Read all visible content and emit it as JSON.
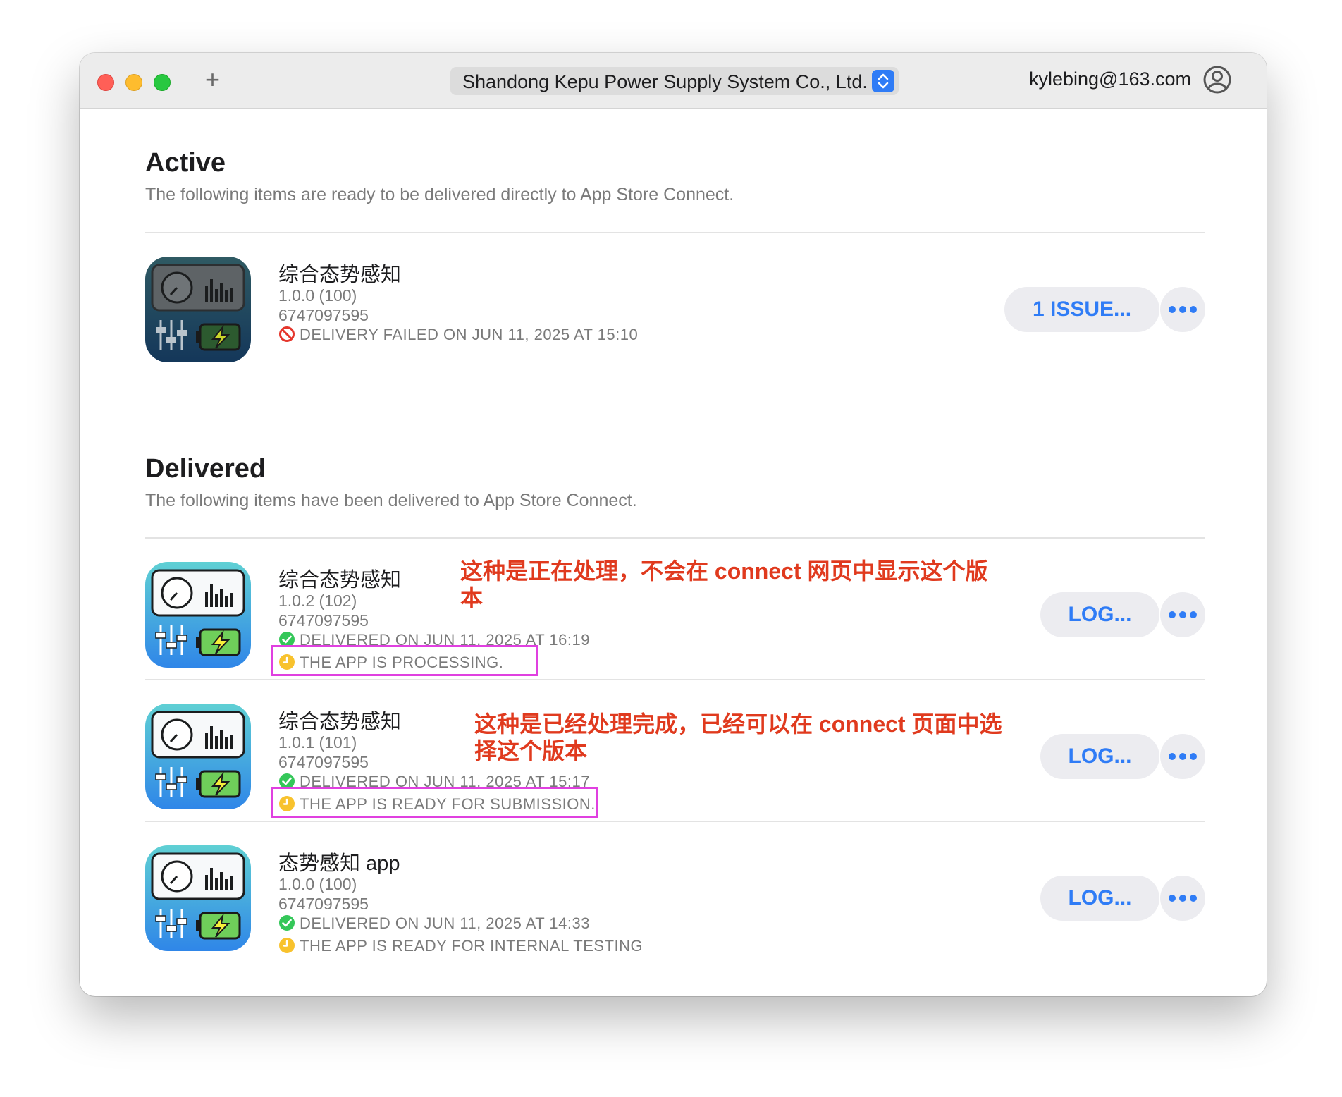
{
  "window": {
    "team": "Shandong Kepu Power Supply System Co., Ltd.",
    "account": "kylebing@163.com"
  },
  "active": {
    "title": "Active",
    "subtitle": "The following items are ready to be delivered directly to App Store Connect.",
    "items": [
      {
        "name": "综合态势感知",
        "version": "1.0.0 (100)",
        "app_id": "6747097595",
        "status": "DELIVERY FAILED ON JUN 11, 2025 AT 15:10",
        "action_label": "1 ISSUE..."
      }
    ]
  },
  "delivered": {
    "title": "Delivered",
    "subtitle": "The following items have been delivered to App Store Connect.",
    "items": [
      {
        "name": "综合态势感知",
        "version": "1.0.2 (102)",
        "app_id": "6747097595",
        "status": "DELIVERED ON JUN 11, 2025 AT 16:19",
        "processing": "THE APP IS PROCESSING.",
        "action_label": "LOG..."
      },
      {
        "name": "综合态势感知",
        "version": "1.0.1 (101)",
        "app_id": "6747097595",
        "status": "DELIVERED ON JUN 11, 2025 AT 15:17",
        "processing": "THE APP IS READY FOR SUBMISSION.",
        "action_label": "LOG..."
      },
      {
        "name": "态势感知 app",
        "version": "1.0.0 (100)",
        "app_id": "6747097595",
        "status": "DELIVERED ON JUN 11, 2025 AT 14:33",
        "processing": "THE APP IS READY FOR INTERNAL TESTING",
        "action_label": "LOG..."
      }
    ]
  },
  "annotations": {
    "processing_note": "这种是正在处理，不会在 connect 网页中显示这个版本",
    "ready_note": "这种是已经处理完成，已经可以在 connect 页面中选择这个版本"
  },
  "colors": {
    "accent": "#2f7cf6",
    "error": "#e5362c",
    "success": "#34c759",
    "pending": "#f8c22d",
    "annotation": "#e03a1e",
    "highlight": "#e040e0"
  },
  "icons": {
    "window_close": "close-dot",
    "window_minimize": "minimize-dot",
    "window_zoom": "zoom-dot",
    "new_tab": "plus-icon",
    "team_menu": "stepper-icon",
    "account": "person-circle-icon",
    "failed": "prohibited-icon",
    "delivered": "checkmark-circle-icon",
    "processing": "clock-icon",
    "more": "ellipsis-icon"
  }
}
